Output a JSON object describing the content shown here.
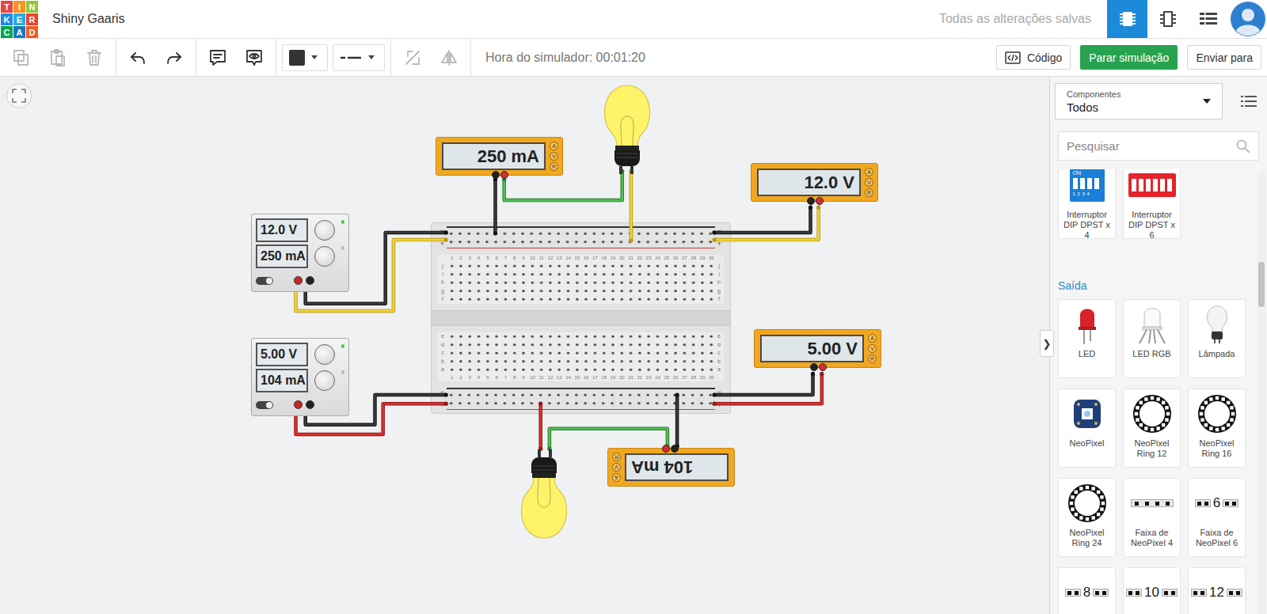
{
  "header": {
    "logo": [
      {
        "letter": "T",
        "color": "#e8453c"
      },
      {
        "letter": "I",
        "color": "#f7931e"
      },
      {
        "letter": "N",
        "color": "#8cc63f"
      },
      {
        "letter": "K",
        "color": "#1e88e5"
      },
      {
        "letter": "E",
        "color": "#29abe2"
      },
      {
        "letter": "R",
        "color": "#ef4136"
      },
      {
        "letter": "C",
        "color": "#00a651"
      },
      {
        "letter": "A",
        "color": "#1c75bc"
      },
      {
        "letter": "D",
        "color": "#f15a24"
      }
    ],
    "title": "Shiny Gaaris",
    "save_status": "Todas as alterações salvas",
    "views": [
      {
        "kind": "circuit",
        "selected": true
      },
      {
        "kind": "schematic",
        "selected": false
      },
      {
        "kind": "list",
        "selected": false
      }
    ]
  },
  "toolbar": {
    "tool_groups": [
      [
        {
          "kind": "copy",
          "disabled": true
        },
        {
          "kind": "paste",
          "disabled": true
        },
        {
          "kind": "trash",
          "disabled": true
        }
      ],
      [
        {
          "kind": "undo",
          "disabled": false
        },
        {
          "kind": "redo",
          "disabled": false
        }
      ],
      [
        {
          "kind": "note",
          "disabled": false
        },
        {
          "kind": "eye",
          "disabled": false
        }
      ],
      [
        {
          "kind": "color",
          "disabled": false
        },
        {
          "kind": "line",
          "disabled": false
        }
      ],
      [
        {
          "kind": "flip",
          "disabled": true
        },
        {
          "kind": "mirror",
          "disabled": true
        }
      ]
    ],
    "wire_color": "#333333",
    "sim_time": "Hora do simulador: 00:01:20",
    "buttons": [
      {
        "label": "Código",
        "kind": "code"
      },
      {
        "label": "Parar simulação",
        "kind": "primary"
      },
      {
        "label": "Enviar para",
        "kind": "plain"
      }
    ]
  },
  "canvas": {
    "breadboard": {
      "columns": [
        "1",
        "2",
        "3",
        "4",
        "5",
        "6",
        "7",
        "8",
        "9",
        "10",
        "11",
        "12",
        "13",
        "14",
        "15",
        "16",
        "17",
        "18",
        "19",
        "20",
        "21",
        "22",
        "23",
        "24",
        "25",
        "26",
        "27",
        "28",
        "29",
        "30"
      ],
      "rows_top": [
        "j",
        "i",
        "h",
        "g",
        "f"
      ],
      "rows_bottom": [
        "e",
        "d",
        "c",
        "b",
        "a"
      ],
      "rail_signs": [
        "−",
        "+"
      ]
    },
    "power_supplies": [
      {
        "voltage": "12.0 V",
        "current": "250 mA",
        "on": true
      },
      {
        "voltage": "5.00 V",
        "current": "104 mA",
        "on": true
      }
    ],
    "multimeters": [
      {
        "reading": "250 mA",
        "modes": [
          "A",
          "V",
          "R"
        ],
        "rotated": false
      },
      {
        "reading": "12.0 V",
        "modes": [
          "A",
          "V",
          "R"
        ],
        "rotated": false
      },
      {
        "reading": "5.00 V",
        "modes": [
          "A",
          "V",
          "R"
        ],
        "rotated": false
      },
      {
        "reading": "104 mA",
        "modes": [
          "A",
          "V",
          "R"
        ],
        "rotated": true
      }
    ],
    "bulbs": [
      {
        "lit": true,
        "rotated": false
      },
      {
        "lit": true,
        "rotated": true
      }
    ]
  },
  "panel": {
    "filter_label": "Componentes",
    "filter_value": "Todos",
    "search": {
      "placeholder": "Pesquisar"
    },
    "collapse_glyph": "❯",
    "top_items": [
      {
        "label": "Interruptor DIP DPST x 4",
        "kind": "dip-blue",
        "icon_text": "ON",
        "icon_sub": "1 2 3 4"
      },
      {
        "label": "Interruptor DIP DPST x 6",
        "kind": "dip-red"
      }
    ],
    "sections": [
      {
        "title": "Saída",
        "items": [
          {
            "label": "LED",
            "kind": "led"
          },
          {
            "label": "LED RGB",
            "kind": "led-rgb"
          },
          {
            "label": "Lâmpada",
            "kind": "bulb"
          },
          {
            "label": "NeoPixel",
            "kind": "neopixel"
          },
          {
            "label": "NeoPixel Ring 12",
            "kind": "ring"
          },
          {
            "label": "NeoPixel Ring 16",
            "kind": "ring"
          },
          {
            "label": "NeoPixel Ring 24",
            "kind": "ring"
          },
          {
            "label": "Faixa de NeoPixel 4",
            "kind": "strip"
          },
          {
            "label": "Faixa de NeoPixel 6",
            "kind": "strip-n",
            "icon_text": "6"
          },
          {
            "kind": "strip-n",
            "icon_text": "8"
          },
          {
            "kind": "strip-n",
            "icon_text": "10"
          },
          {
            "kind": "strip-n",
            "icon_text": "12"
          }
        ]
      }
    ]
  }
}
